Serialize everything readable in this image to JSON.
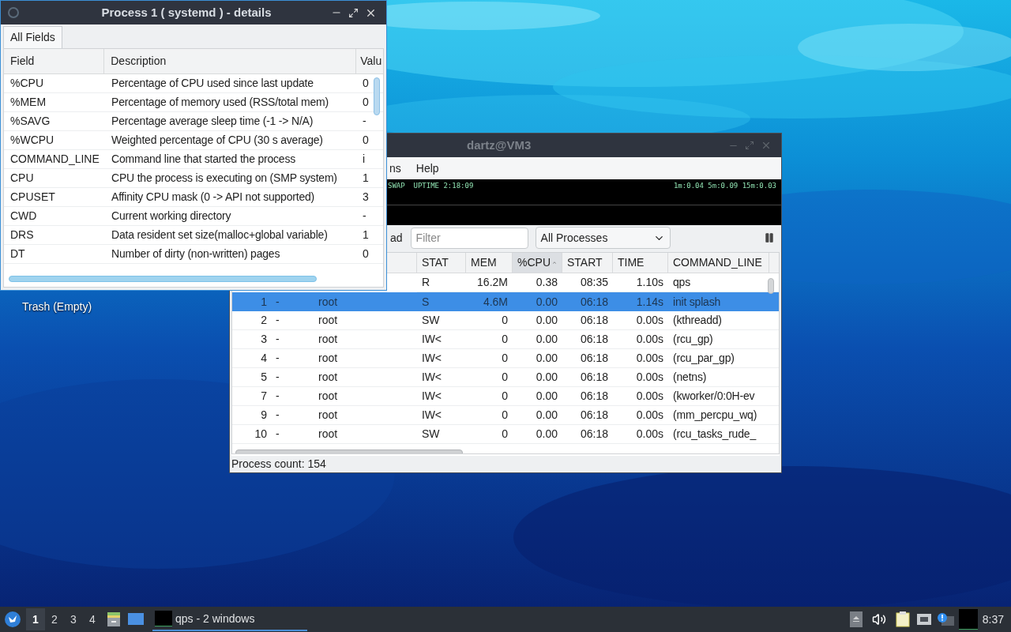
{
  "desktop": {
    "icons": [
      {
        "label": "Trash (Empty)"
      }
    ]
  },
  "details_window": {
    "title": "Process 1 ( systemd ) - details",
    "tabs": [
      {
        "label": "All Fields",
        "selected": true
      }
    ],
    "columns": [
      "Field",
      "Description",
      "Valu"
    ],
    "rows": [
      {
        "field": "%CPU",
        "description": "Percentage of CPU used since last update",
        "value": "0"
      },
      {
        "field": "%MEM",
        "description": "Percentage of memory used (RSS/total mem)",
        "value": "0"
      },
      {
        "field": "%SAVG",
        "description": "Percentage average sleep time (-1 -> N/A)",
        "value": "-"
      },
      {
        "field": "%WCPU",
        "description": "Weighted percentage of CPU (30 s average)",
        "value": "0"
      },
      {
        "field": "COMMAND_LINE",
        "description": "Command line that started the process",
        "value": "i"
      },
      {
        "field": "CPU",
        "description": "CPU the process is executing on (SMP system)",
        "value": "1"
      },
      {
        "field": "CPUSET",
        "description": "Affinity CPU mask (0 -> API not supported)",
        "value": "3"
      },
      {
        "field": "CWD",
        "description": "Current working directory",
        "value": "-"
      },
      {
        "field": "DRS",
        "description": "Data resident set size(malloc+global variable)",
        "value": "1"
      },
      {
        "field": "DT",
        "description": "Number of dirty (non-written) pages",
        "value": "0"
      }
    ]
  },
  "main_window": {
    "title": "dartz@VM3",
    "menu": [
      "ns",
      "Help"
    ],
    "info_left": "SWAP  UPTIME 2:18:09",
    "info_right": "1m:0.04 5m:0.09 15m:0.03",
    "toolbar_label": "ad",
    "filter": {
      "placeholder": "Filter"
    },
    "view_select": {
      "value": "All Processes"
    },
    "columns": [
      {
        "label": "STAT",
        "sorted": false
      },
      {
        "label": "MEM",
        "sorted": false
      },
      {
        "label": "%CPU",
        "sorted": true
      },
      {
        "label": "START",
        "sorted": false
      },
      {
        "label": "TIME",
        "sorted": false
      },
      {
        "label": "COMMAND_LINE",
        "sorted": false
      }
    ],
    "rows": [
      {
        "stat": "R",
        "mem": "16.2M",
        "cpu": "0.38",
        "start": "08:35",
        "time": "1.10s",
        "command": "qps",
        "selected": false
      },
      {
        "pid": "1",
        "tty": "-",
        "user": "root",
        "stat": "S",
        "mem": "4.6M",
        "cpu": "0.00",
        "start": "06:18",
        "time": "1.14s",
        "command": "init splash",
        "selected": true
      },
      {
        "pid": "2",
        "tty": "-",
        "user": "root",
        "stat": "SW",
        "mem": "0",
        "cpu": "0.00",
        "start": "06:18",
        "time": "0.00s",
        "command": "(kthreadd)",
        "selected": false
      },
      {
        "pid": "3",
        "tty": "-",
        "user": "root",
        "stat": "IW<",
        "mem": "0",
        "cpu": "0.00",
        "start": "06:18",
        "time": "0.00s",
        "command": "(rcu_gp)",
        "selected": false
      },
      {
        "pid": "4",
        "tty": "-",
        "user": "root",
        "stat": "IW<",
        "mem": "0",
        "cpu": "0.00",
        "start": "06:18",
        "time": "0.00s",
        "command": "(rcu_par_gp)",
        "selected": false
      },
      {
        "pid": "5",
        "tty": "-",
        "user": "root",
        "stat": "IW<",
        "mem": "0",
        "cpu": "0.00",
        "start": "06:18",
        "time": "0.00s",
        "command": "(netns)",
        "selected": false
      },
      {
        "pid": "7",
        "tty": "-",
        "user": "root",
        "stat": "IW<",
        "mem": "0",
        "cpu": "0.00",
        "start": "06:18",
        "time": "0.00s",
        "command": "(kworker/0:0H-ev",
        "selected": false
      },
      {
        "pid": "9",
        "tty": "-",
        "user": "root",
        "stat": "IW<",
        "mem": "0",
        "cpu": "0.00",
        "start": "06:18",
        "time": "0.00s",
        "command": "(mm_percpu_wq)",
        "selected": false
      },
      {
        "pid": "10",
        "tty": "-",
        "user": "root",
        "stat": "SW",
        "mem": "0",
        "cpu": "0.00",
        "start": "06:18",
        "time": "0.00s",
        "command": "(rcu_tasks_rude_",
        "selected": false
      }
    ],
    "status": "Process count: 154"
  },
  "taskbar": {
    "workspaces": [
      {
        "label": "1",
        "selected": true
      },
      {
        "label": "2",
        "selected": false
      },
      {
        "label": "3",
        "selected": false
      },
      {
        "label": "4",
        "selected": false
      }
    ],
    "task": {
      "label": "qps - 2 windows"
    },
    "clock": "8:37"
  }
}
